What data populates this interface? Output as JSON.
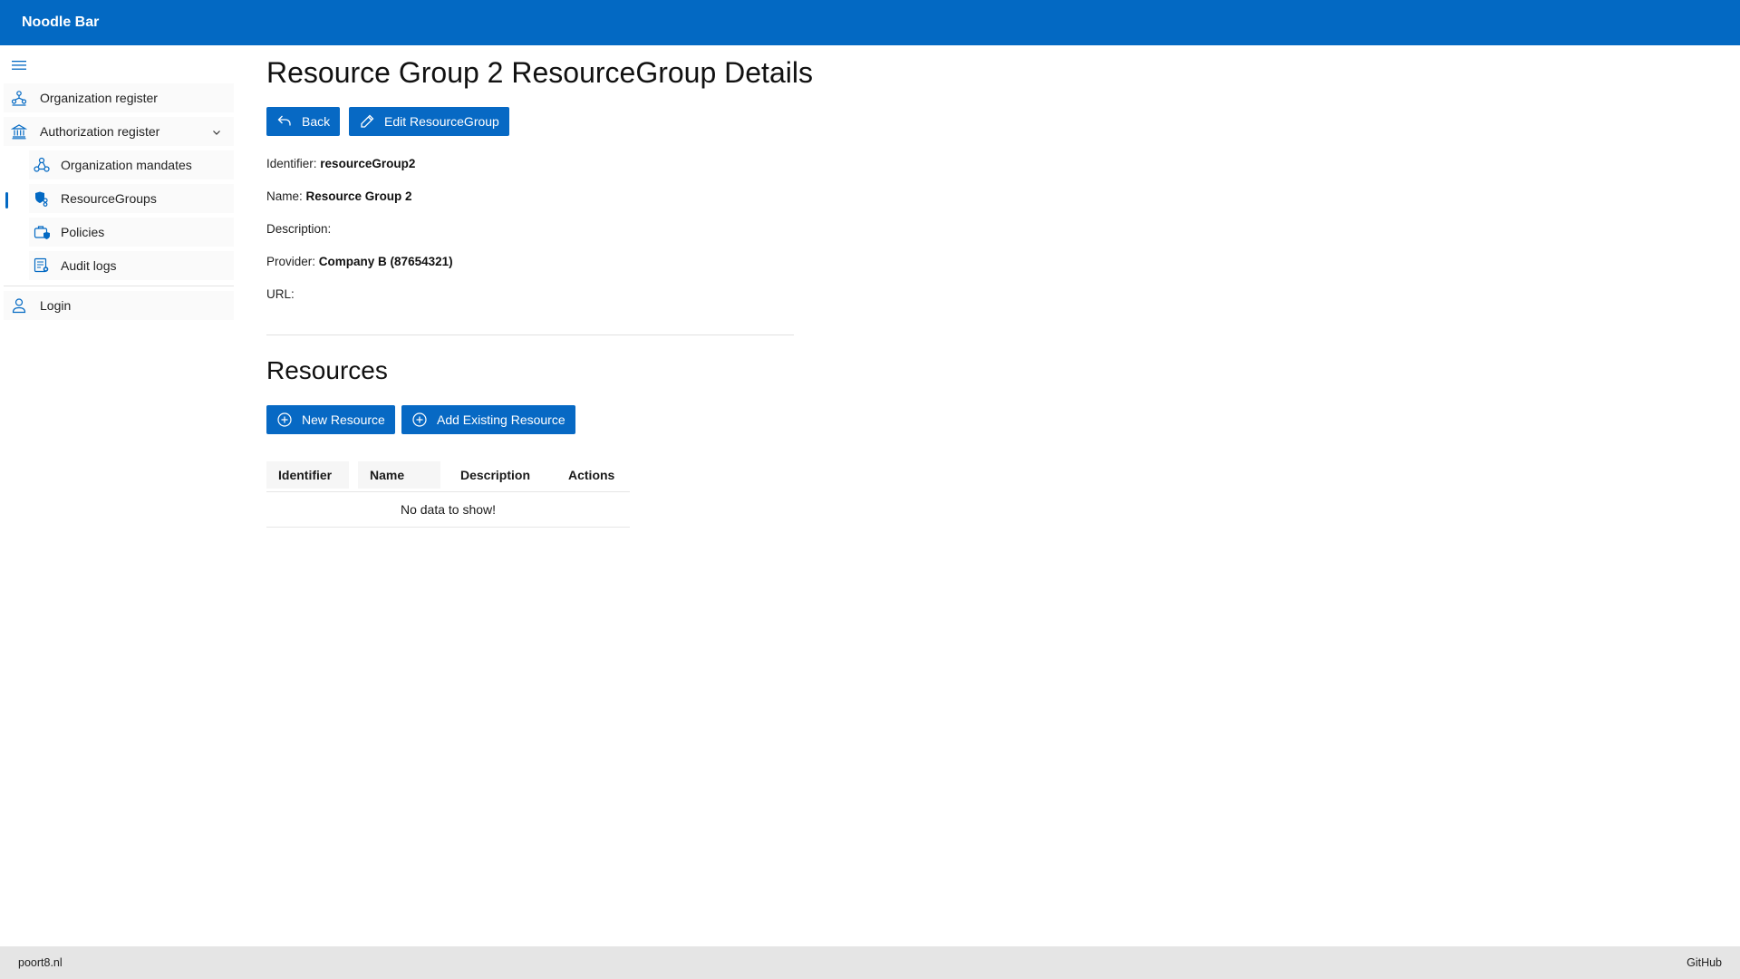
{
  "header": {
    "brand": "Noodle Bar"
  },
  "sidebar": {
    "items": [
      {
        "label": "Organization register",
        "icon": "organization-icon"
      },
      {
        "label": "Authorization register",
        "icon": "bank-icon",
        "expanded": true
      },
      {
        "label": "Organization mandates",
        "icon": "people-network-icon"
      },
      {
        "label": "ResourceGroups",
        "icon": "shield-group-icon",
        "active": true
      },
      {
        "label": "Policies",
        "icon": "briefcase-shield-icon"
      },
      {
        "label": "Audit logs",
        "icon": "document-search-icon"
      },
      {
        "label": "Login",
        "icon": "person-icon"
      }
    ]
  },
  "main": {
    "title": "Resource Group 2 ResourceGroup Details",
    "buttons": {
      "back": "Back",
      "edit": "Edit ResourceGroup"
    },
    "fields": {
      "identifier_label": "Identifier:",
      "identifier_value": "resourceGroup2",
      "name_label": "Name:",
      "name_value": "Resource Group 2",
      "description_label": "Description:",
      "description_value": "",
      "provider_label": "Provider:",
      "provider_value": "Company B (87654321)",
      "url_label": "URL:",
      "url_value": ""
    },
    "resources": {
      "title": "Resources",
      "new_button": "New Resource",
      "add_existing_button": "Add Existing Resource",
      "columns": [
        "Identifier",
        "Name",
        "Description",
        "Actions"
      ],
      "empty_text": "No data to show!"
    }
  },
  "footer": {
    "left": "poort8.nl",
    "right": "GitHub"
  },
  "colors": {
    "accent": "#0369c3",
    "footer_bg": "#e5e5e5"
  }
}
